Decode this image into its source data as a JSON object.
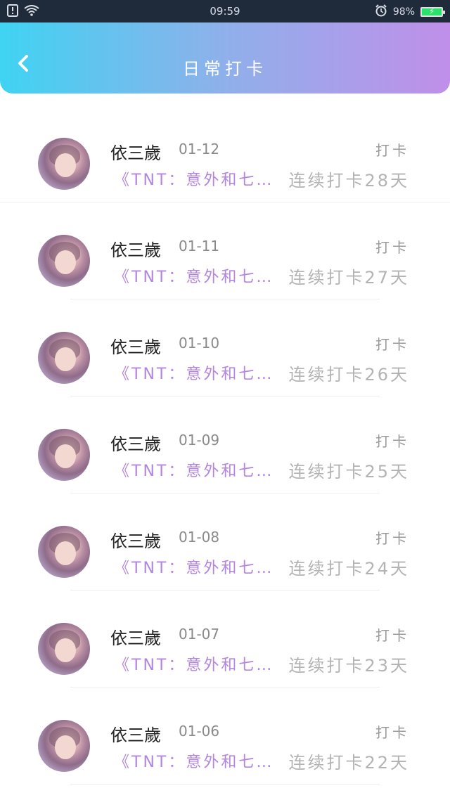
{
  "status": {
    "time": "09:59",
    "battery": "98%"
  },
  "header": {
    "title": "日常打卡"
  },
  "items": [
    {
      "name": "依三歲",
      "date": "01-12",
      "tag": "打卡",
      "book": "《TNT：意外和七…",
      "streak": "连续打卡28天"
    },
    {
      "name": "依三歲",
      "date": "01-11",
      "tag": "打卡",
      "book": "《TNT：意外和七…",
      "streak": "连续打卡27天"
    },
    {
      "name": "依三歲",
      "date": "01-10",
      "tag": "打卡",
      "book": "《TNT：意外和七…",
      "streak": "连续打卡26天"
    },
    {
      "name": "依三歲",
      "date": "01-09",
      "tag": "打卡",
      "book": "《TNT：意外和七…",
      "streak": "连续打卡25天"
    },
    {
      "name": "依三歲",
      "date": "01-08",
      "tag": "打卡",
      "book": "《TNT：意外和七…",
      "streak": "连续打卡24天"
    },
    {
      "name": "依三歲",
      "date": "01-07",
      "tag": "打卡",
      "book": "《TNT：意外和七…",
      "streak": "连续打卡23天"
    },
    {
      "name": "依三歲",
      "date": "01-06",
      "tag": "打卡",
      "book": "《TNT：意外和七…",
      "streak": "连续打卡22天"
    }
  ]
}
